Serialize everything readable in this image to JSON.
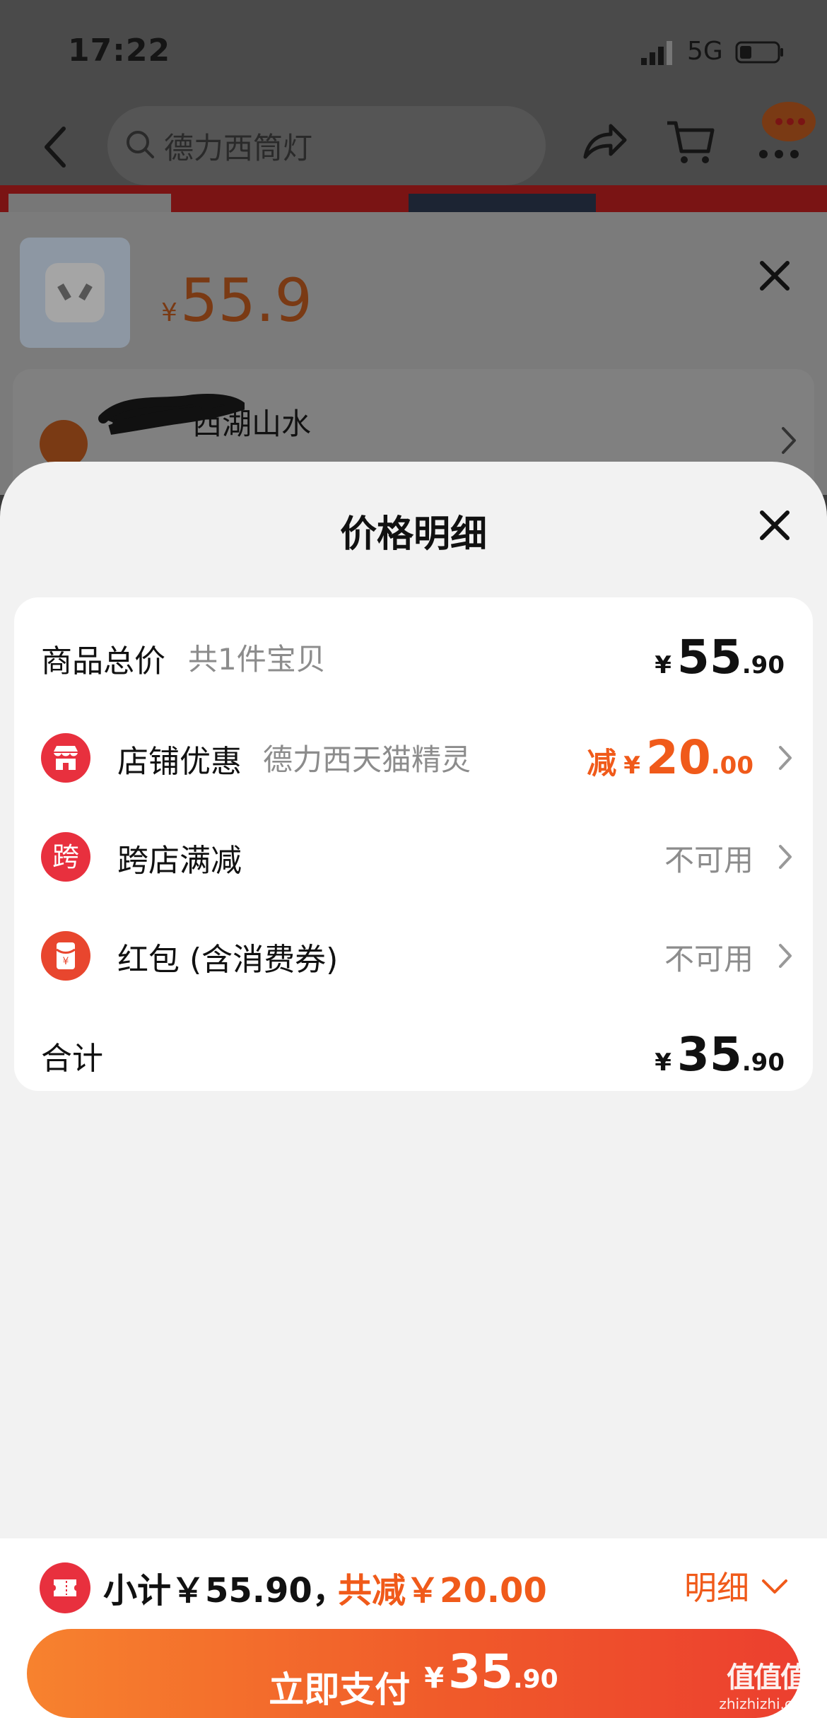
{
  "status_bar": {
    "time": "17:22",
    "network": "5G"
  },
  "search": {
    "placeholder": "德力西筒灯"
  },
  "product": {
    "price_symbol": "¥",
    "price": "55.9"
  },
  "address": {
    "text": "西湖山水"
  },
  "sheet": {
    "title": "价格明细"
  },
  "rows": [
    {
      "label": "商品总价",
      "sub": "共1件宝贝",
      "yen": "¥",
      "int": "55",
      "dec": ".90"
    },
    {
      "icon_text": "",
      "icon": "store-icon",
      "label": "店铺优惠",
      "sub": "德力西天猫精灵",
      "prefix": "减",
      "yen": "¥",
      "int": "20",
      "dec": ".00"
    },
    {
      "icon_text": "跨",
      "icon": "cross-store-icon",
      "label": "跨店满减",
      "value": "不可用"
    },
    {
      "icon": "red-packet-icon",
      "label": "红包 (含消费券)",
      "value": "不可用"
    },
    {
      "label": "合计",
      "yen": "¥",
      "int": "35",
      "dec": ".90"
    }
  ],
  "bottom": {
    "subtotal": "小计￥55.90，",
    "discount": "共减￥20.00",
    "detail": "明细",
    "pay_label": "立即支付",
    "pay_yen": "¥",
    "pay_int": "35",
    "pay_dec": ".90"
  },
  "watermark": {
    "logo": "值值值",
    "url": "zhizhizhi.com"
  },
  "colors": {
    "accent": "#f05a1a",
    "red": "#e8303e",
    "sheet_bg": "#f2f2f2"
  }
}
